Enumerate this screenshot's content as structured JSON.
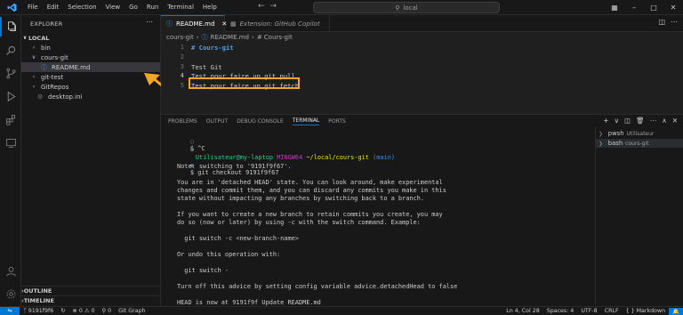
{
  "titlebar": {
    "menu": [
      "File",
      "Edit",
      "Selection",
      "View",
      "Go",
      "Run",
      "Terminal",
      "Help"
    ],
    "search_text": "local"
  },
  "sidebar": {
    "title": "EXPLORER",
    "root": "LOCAL",
    "tree": [
      {
        "label": "bin",
        "type": "folder",
        "level": 1,
        "expanded": false
      },
      {
        "label": "cours-git",
        "type": "folder",
        "level": 1,
        "expanded": true
      },
      {
        "label": "README.md",
        "type": "file",
        "level": 2,
        "selected": true
      },
      {
        "label": "git-test",
        "type": "folder",
        "level": 1,
        "expanded": false
      },
      {
        "label": "GitRepos",
        "type": "folder",
        "level": 1,
        "expanded": false
      },
      {
        "label": "desktop.ini",
        "type": "file",
        "level": 1
      }
    ],
    "outline": "OUTLINE",
    "timeline": "TIMELINE"
  },
  "tabs": [
    {
      "label": "README.md",
      "active": true
    },
    {
      "label": "Extension: GitHub Copilot",
      "active": false
    }
  ],
  "breadcrumb": [
    "cours-git",
    "README.md",
    "# Cours-git"
  ],
  "editor": {
    "lines": [
      {
        "n": "1",
        "text": "# Cours-git"
      },
      {
        "n": "2",
        "text": ""
      },
      {
        "n": "3",
        "text": "Test Git"
      },
      {
        "n": "4",
        "text": "Test pour faire un git pull"
      },
      {
        "n": "5",
        "text": "Test pour faire un git fetch"
      }
    ]
  },
  "panel": {
    "tabs": [
      "PROBLEMS",
      "OUTPUT",
      "DEBUG CONSOLE",
      "TERMINAL",
      "PORTS"
    ],
    "active_tab": "TERMINAL",
    "terminal": {
      "interrupt": "$ ^C",
      "prompt_user": "Utilisateur@my-laptop",
      "prompt_env": "MINGW64",
      "prompt_path": "~/local/cours-git",
      "prompt_branch": "(main)",
      "command": "$ git checkout 9191f9f67",
      "output": [
        "Note: switching to '9191f9f67'.",
        "",
        "You are in 'detached HEAD' state. You can look around, make experimental",
        "changes and commit them, and you can discard any commits you make in this",
        "state without impacting any branches by switching back to a branch.",
        "",
        "If you want to create a new branch to retain commits you create, you may",
        "do so (now or later) by using -c with the switch command. Example:",
        "",
        "  git switch -c <new-branch-name>",
        "",
        "Or undo this operation with:",
        "",
        "  git switch -",
        "",
        "Turn off this advice by setting config variable advice.detachedHead to false",
        "",
        "HEAD is now at 9191f9f Update README.md"
      ]
    },
    "terminal_list": [
      {
        "name": "pwsh",
        "sub": "Utilisateur"
      },
      {
        "name": "bash",
        "sub": "cours-git"
      }
    ]
  },
  "statusbar": {
    "commit": "9191f9f6",
    "errors": "0",
    "warnings": "0",
    "ports": "0",
    "graph": "Git Graph",
    "position": "Ln 4, Col 28",
    "spaces": "Spaces: 4",
    "encoding": "UTF-8",
    "eol": "CRLF",
    "language": "Markdown"
  },
  "colors": {
    "accent": "#0078d4",
    "annotation": "#f5a623"
  }
}
